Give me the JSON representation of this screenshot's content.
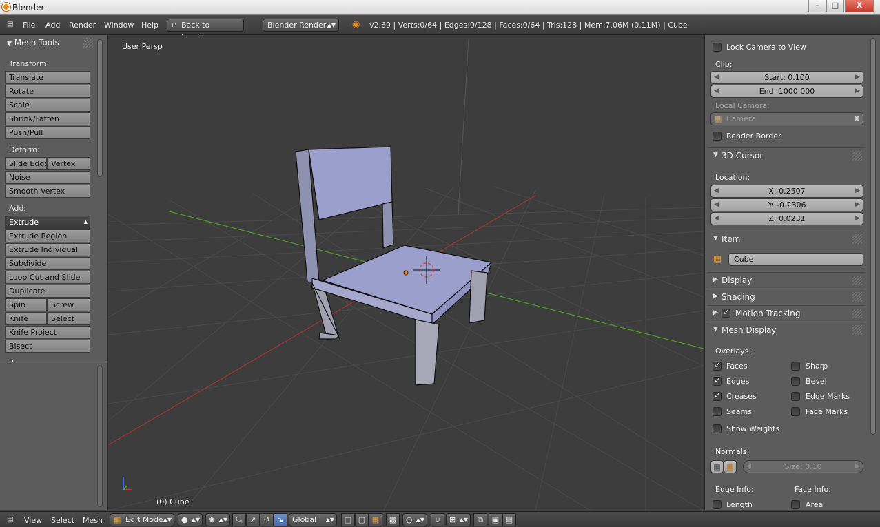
{
  "window": {
    "title": "Blender",
    "controls": {
      "minimize": "–",
      "maximize": "□",
      "close": "X"
    }
  },
  "menu": {
    "items": [
      "File",
      "Add",
      "Render",
      "Window",
      "Help"
    ],
    "back_button": "Back to Previous",
    "render_engine": "Blender Render",
    "stats": "v2.69 | Verts:0/64 | Edges:0/128 | Faces:0/64 | Tris:128 | Mem:7.06M (0.11M) | Cube"
  },
  "toolshelf": {
    "title": "Mesh Tools",
    "transform_label": "Transform:",
    "transform": [
      "Translate",
      "Rotate",
      "Scale",
      "Shrink/Fatten",
      "Push/Pull"
    ],
    "deform_label": "Deform:",
    "deform_row": [
      "Slide Edge",
      "Vertex"
    ],
    "deform": [
      "Noise",
      "Smooth Vertex"
    ],
    "add_label": "Add:",
    "extrude": "Extrude",
    "add": [
      "Extrude Region",
      "Extrude Individual",
      "Subdivide",
      "Loop Cut and Slide",
      "Duplicate"
    ],
    "pair1": [
      "Spin",
      "Screw"
    ],
    "pair2": [
      "Knife",
      "Select"
    ],
    "add_after": [
      "Knife Project",
      "Bisect"
    ],
    "cut_label": "R..."
  },
  "viewport": {
    "view_label": "User Persp",
    "object_label": "(0) Cube"
  },
  "properties": {
    "lock_camera": "Lock Camera to View",
    "clip_label": "Clip:",
    "clip_start": "Start: 0.100",
    "clip_end": "End: 1000.000",
    "local_camera_label": "Local Camera:",
    "camera_placeholder": "Camera",
    "render_border": "Render Border",
    "cursor_title": "3D Cursor",
    "location_label": "Location:",
    "loc_x": "X: 0.2507",
    "loc_y": "Y: -0.2306",
    "loc_z": "Z: 0.0231",
    "item_title": "Item",
    "item_name": "Cube",
    "display_title": "Display",
    "shading_title": "Shading",
    "motion_title": "Motion Tracking",
    "mesh_display_title": "Mesh Display",
    "overlays_label": "Overlays:",
    "overlays_left": [
      {
        "label": "Faces",
        "checked": true
      },
      {
        "label": "Edges",
        "checked": true
      },
      {
        "label": "Creases",
        "checked": true
      },
      {
        "label": "Seams",
        "checked": false
      }
    ],
    "overlays_right": [
      {
        "label": "Sharp",
        "checked": false
      },
      {
        "label": "Bevel",
        "checked": false
      },
      {
        "label": "Edge Marks",
        "checked": false
      },
      {
        "label": "Face Marks",
        "checked": false
      }
    ],
    "show_weights": "Show Weights",
    "normals_label": "Normals:",
    "normals_size": "Size: 0.10",
    "edge_info": "Edge Info:",
    "face_info": "Face Info:",
    "length": "Length",
    "area": "Area"
  },
  "footer": {
    "view": "View",
    "select": "Select",
    "mesh": "Mesh",
    "mode": "Edit Mode",
    "orientation": "Global"
  },
  "colors": {
    "accent": "#4a6ea8",
    "x_axis": "#a83232",
    "y_axis": "#4a9a2a",
    "chair": "#9b9fcc"
  }
}
